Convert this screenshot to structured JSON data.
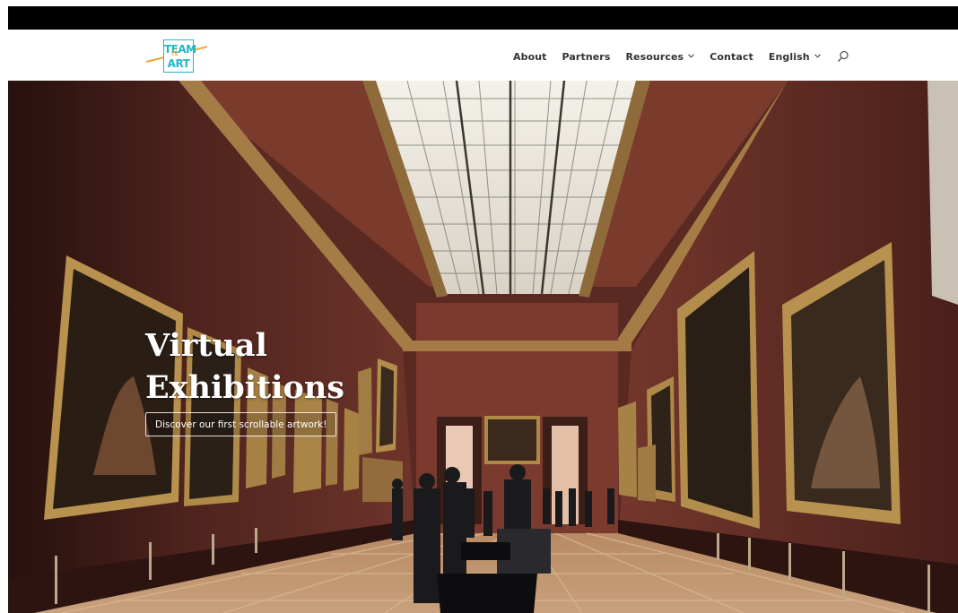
{
  "logo": {
    "line1": "TEAM",
    "amp": "&",
    "line2": "ART"
  },
  "nav": {
    "items": [
      {
        "label": "About",
        "has_dropdown": false
      },
      {
        "label": "Partners",
        "has_dropdown": false
      },
      {
        "label": "Resources",
        "has_dropdown": true
      },
      {
        "label": "Contact",
        "has_dropdown": false
      },
      {
        "label": "English",
        "has_dropdown": true
      }
    ],
    "search_icon": "search-icon"
  },
  "hero": {
    "title_line1": "Virtual",
    "title_line2": "Exhibitions",
    "button_label": "Discover our first scrollable artwork!"
  },
  "colors": {
    "brand_teal": "#1fb8c9",
    "brand_orange": "#f4a232",
    "topbar": "#000000",
    "nav_text": "#333333",
    "wall": "#6b3128"
  }
}
